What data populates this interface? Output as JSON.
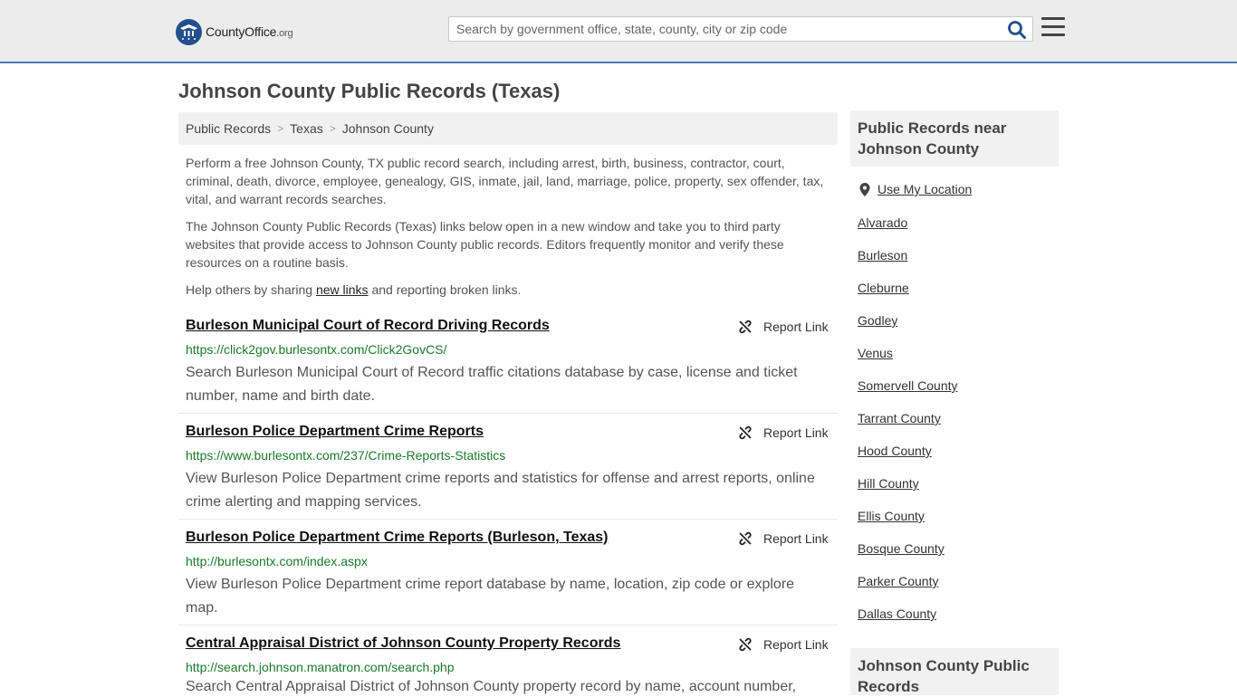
{
  "header": {
    "logo_main": "CountyOffice",
    "logo_org": ".org",
    "search_placeholder": "Search by government office, state, county, city or zip code"
  },
  "page": {
    "title": "Johnson County Public Records (Texas)"
  },
  "breadcrumb": [
    "Public Records",
    "Texas",
    "Johnson County"
  ],
  "intro": {
    "p1": "Perform a free Johnson County, TX public record search, including arrest, birth, business, contractor, court, criminal, death, divorce, employee, genealogy, GIS, inmate, jail, land, marriage, police, property, sex offender, tax, vital, and warrant records searches.",
    "p2": "The Johnson County Public Records (Texas) links below open in a new window and take you to third party websites that provide access to Johnson County public records. Editors frequently monitor and verify these resources on a routine basis.",
    "p3_before": "Help others by sharing ",
    "p3_link": "new links",
    "p3_after": " and reporting broken links."
  },
  "report_label": "Report Link",
  "results": [
    {
      "title": "Burleson Municipal Court of Record Driving Records",
      "url": "https://click2gov.burlesontx.com/Click2GovCS/",
      "desc": "Search Burleson Municipal Court of Record traffic citations database by case, license and ticket number, name and birth date."
    },
    {
      "title": "Burleson Police Department Crime Reports",
      "url": "https://www.burlesontx.com/237/Crime-Reports-Statistics",
      "desc": "View Burleson Police Department crime reports and statistics for offense and arrest reports, online crime alerting and mapping services."
    },
    {
      "title": "Burleson Police Department Crime Reports (Burleson, Texas)",
      "url": "http://burlesontx.com/index.aspx",
      "desc": "View Burleson Police Department crime report database by name, location, zip code or explore map."
    },
    {
      "title": "Central Appraisal District of Johnson County Property Records",
      "url": "http://search.johnson.manatron.com/search.php",
      "desc": "Search Central Appraisal District of Johnson County property record by name, account number,"
    }
  ],
  "sidebar": {
    "near_title": "Public Records near Johnson County",
    "use_location": "Use My Location",
    "links": [
      "Alvarado",
      "Burleson",
      "Cleburne",
      "Godley",
      "Venus",
      "Somervell County",
      "Tarrant County",
      "Hood County",
      "Hill County",
      "Ellis County",
      "Bosque County",
      "Parker County",
      "Dallas County"
    ],
    "bottom_title": "Johnson County Public Records"
  },
  "colors": {
    "brand": "#23508c",
    "url_green": "#1a7a2a",
    "header_bg": "#ececec",
    "header_border": "#4a7ab5"
  }
}
